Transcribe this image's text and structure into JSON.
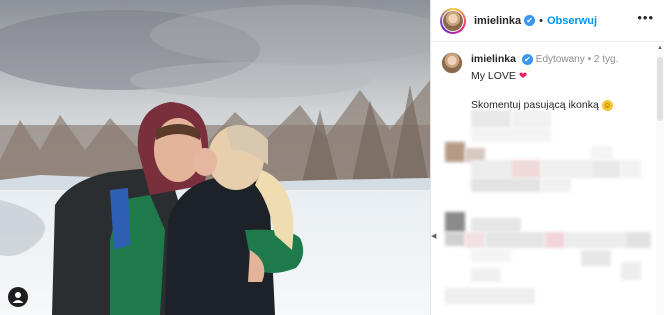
{
  "post": {
    "username": "imielinka",
    "follow_label": "Obserwuj",
    "more_label": "•••"
  },
  "caption": {
    "username": "imielinka",
    "edited_label": "Edytowany",
    "age": "2 tyg.",
    "line1": "My LOVE",
    "line1_emoji": "❤",
    "line2": "Skomentuj pasującą ikonką",
    "line2_emoji": "☺"
  },
  "icons": {
    "verified": "verified-badge-icon",
    "tag": "user-tag-icon",
    "more": "more-options-icon"
  },
  "colors": {
    "follow": "#0095f6",
    "verified": "#3897f0",
    "heart": "#e0245e"
  }
}
